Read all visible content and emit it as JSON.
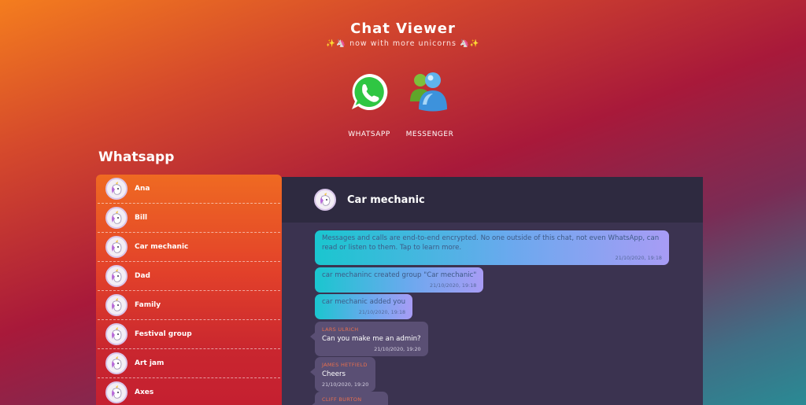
{
  "app": {
    "title": "Chat Viewer",
    "subtitle": "✨🦄 now with more unicorns 🦄✨"
  },
  "platforms": [
    {
      "label": "WHATSAPP",
      "icon": "whatsapp-icon",
      "color": "#2fc643"
    },
    {
      "label": "MESSENGER",
      "icon": "messenger-icon",
      "color": "#4aa0e6"
    }
  ],
  "section": {
    "title": "Whatsapp"
  },
  "contacts": [
    {
      "name": "Ana"
    },
    {
      "name": "Bill"
    },
    {
      "name": "Car mechanic"
    },
    {
      "name": "Dad"
    },
    {
      "name": "Family"
    },
    {
      "name": "Festival group"
    },
    {
      "name": "Art jam"
    },
    {
      "name": "Axes"
    }
  ],
  "chat": {
    "title": "Car mechanic",
    "messages": [
      {
        "type": "system",
        "text": "Messages and calls are end-to-end encrypted. No one outside of this chat, not even WhatsApp, can read or listen to them. Tap to learn more.",
        "time": "21/10/2020, 19:18"
      },
      {
        "type": "system",
        "text": "car mechaninc created group \"Car mechanic\"",
        "time": "21/10/2020, 19:18"
      },
      {
        "type": "system",
        "text": "car mechanic added you",
        "time": "21/10/2020, 19:18"
      },
      {
        "type": "user",
        "sender": "LARS ULRICH",
        "text": "Can you make me an admin?",
        "time": "21/10/2020, 19:20"
      },
      {
        "type": "user",
        "sender": "JAMES HETFIELD",
        "text": "Cheers",
        "time": "21/10/2020, 19:20"
      },
      {
        "type": "user",
        "sender": "CLIFF BURTON",
        "text": "",
        "time": ""
      }
    ]
  },
  "colors": {
    "sidebar_top": "#ef6a22",
    "chat_bg": "#3b3350",
    "chat_header_bg": "#2e2a40",
    "user_bubble": "#5a4f74",
    "sender_name": "#e86f4d"
  }
}
